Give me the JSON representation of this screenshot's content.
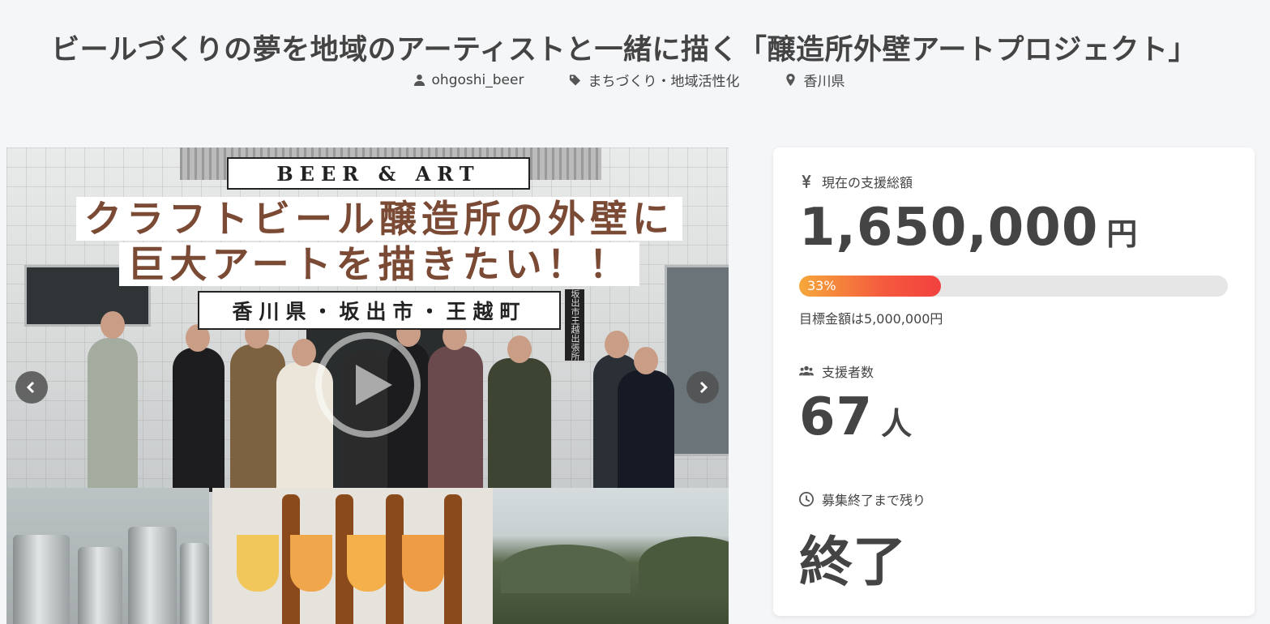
{
  "project": {
    "title": "ビールづくりの夢を地域のアーティストと一緒に描く「醸造所外壁アートプロジェクト」",
    "meta": {
      "owner": "ohgoshi_beer",
      "category": "まちづくり・地域活性化",
      "location": "香川県"
    }
  },
  "hero": {
    "badge": "BEER & ART",
    "headline_line1": "クラフトビール醸造所の外壁に",
    "headline_line2": "巨大アートを描きたい！！",
    "place": "香川県・坂出市・王越町",
    "sign_text": "坂出市王越出張所"
  },
  "stats": {
    "total_label": "現在の支援総額",
    "total_amount": "1,650,000",
    "total_unit": "円",
    "progress_percent": 33,
    "progress_label": "33%",
    "goal_text": "目標金額は5,000,000円",
    "backers_label": "支援者数",
    "backers_count": "67",
    "backers_unit": "人",
    "remaining_label": "募集終了まで残り",
    "remaining_value": "終了"
  },
  "icons": {
    "owner": "user-icon",
    "category": "tag-icon",
    "location": "map-pin-icon",
    "total": "yen-icon",
    "backers": "users-icon",
    "remaining": "clock-icon",
    "prev": "chevron-left-icon",
    "next": "chevron-right-icon",
    "play": "play-icon"
  },
  "colors": {
    "background": "#f5f6f8",
    "progress_start": "#f6a73b",
    "progress_end": "#f2413f",
    "headline_text": "#7a4a35"
  }
}
